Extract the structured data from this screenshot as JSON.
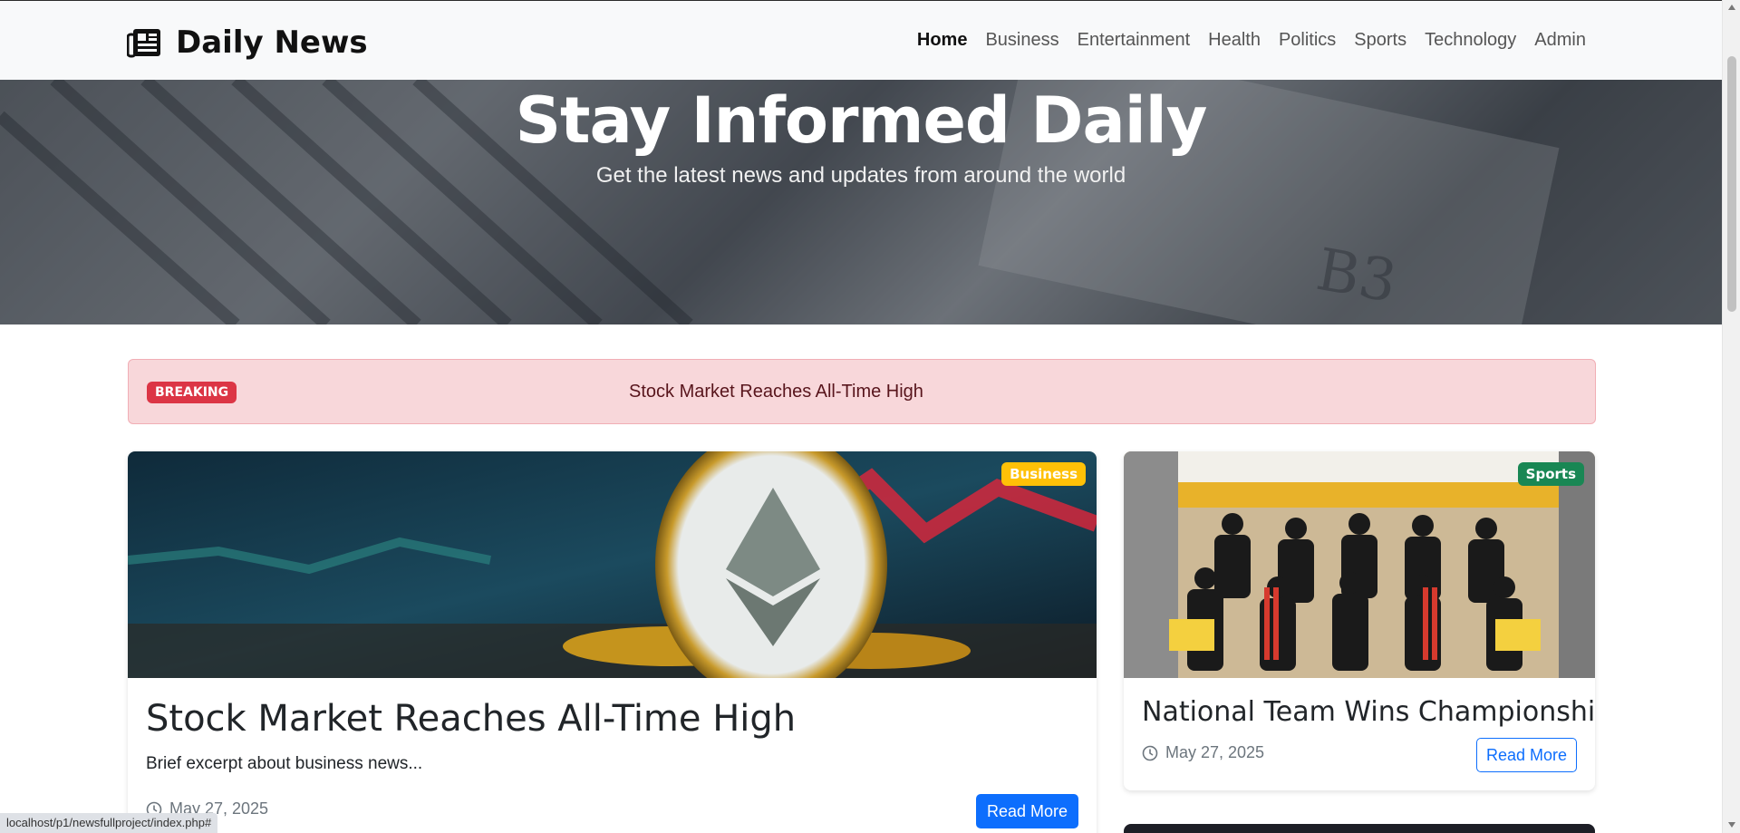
{
  "navbar": {
    "brand": "Daily News",
    "brand_icon": "newspaper-icon",
    "links": [
      "Home",
      "Business",
      "Entertainment",
      "Health",
      "Politics",
      "Sports",
      "Technology",
      "Admin"
    ],
    "active": "Home"
  },
  "hero": {
    "title": "Stay Informed Daily",
    "subtitle": "Get the latest news and updates from around the world"
  },
  "breaking": {
    "badge": "BREAKING",
    "headline": "Stock Market Reaches All-Time High"
  },
  "main_article": {
    "category": "Business",
    "title": "Stock Market Reaches All-Time High",
    "excerpt": "Brief excerpt about business news...",
    "date": "May 27, 2025",
    "button": "Read More"
  },
  "side_article": {
    "category": "Sports",
    "title": "National Team Wins Championship",
    "date": "May 27, 2025",
    "button": "Read More"
  },
  "status_bar": {
    "url": "localhost/p1/newsfullproject/index.php#"
  },
  "colors": {
    "primary": "#0d6efd",
    "danger": "#dc3545",
    "warning": "#ffc107",
    "success": "#198754",
    "breaking_bg": "#f8d7da"
  }
}
